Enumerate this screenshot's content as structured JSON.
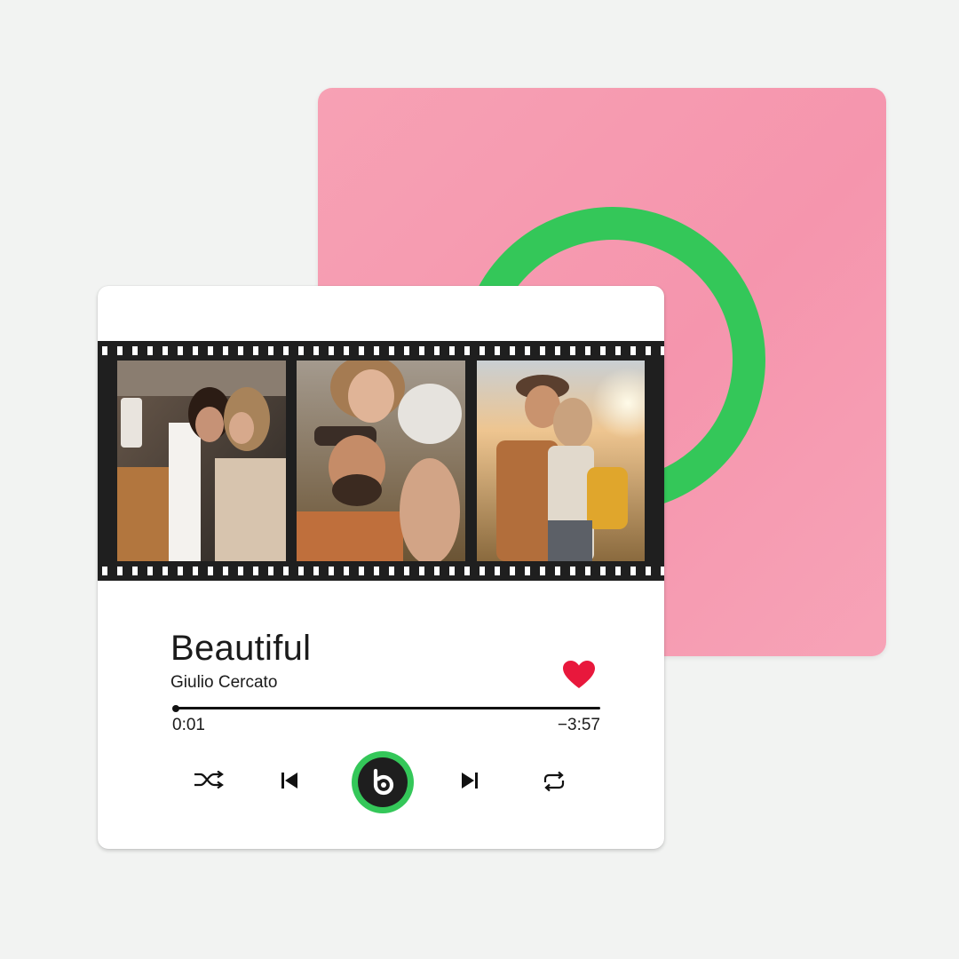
{
  "track": {
    "title": "Beautiful",
    "artist": "Giulio Cercato",
    "elapsed": "0:01",
    "remaining": "−3:57",
    "progress": 0.004,
    "liked": true
  },
  "controls": {
    "shuffle_icon": "shuffle-icon",
    "previous_icon": "skip-previous-icon",
    "play_icon": "brand-logo-play-icon",
    "next_icon": "skip-next-icon",
    "repeat_icon": "repeat-icon"
  },
  "colors": {
    "accent_green": "#34c759",
    "heart_red": "#e8183c",
    "back_card_pink": "#f595ad",
    "filmstrip": "#1f1f1f"
  },
  "filmstrip": {
    "photos": [
      "couple-kissing-in-car",
      "couple-selfie-in-field",
      "couple-embracing-at-sunset"
    ]
  }
}
